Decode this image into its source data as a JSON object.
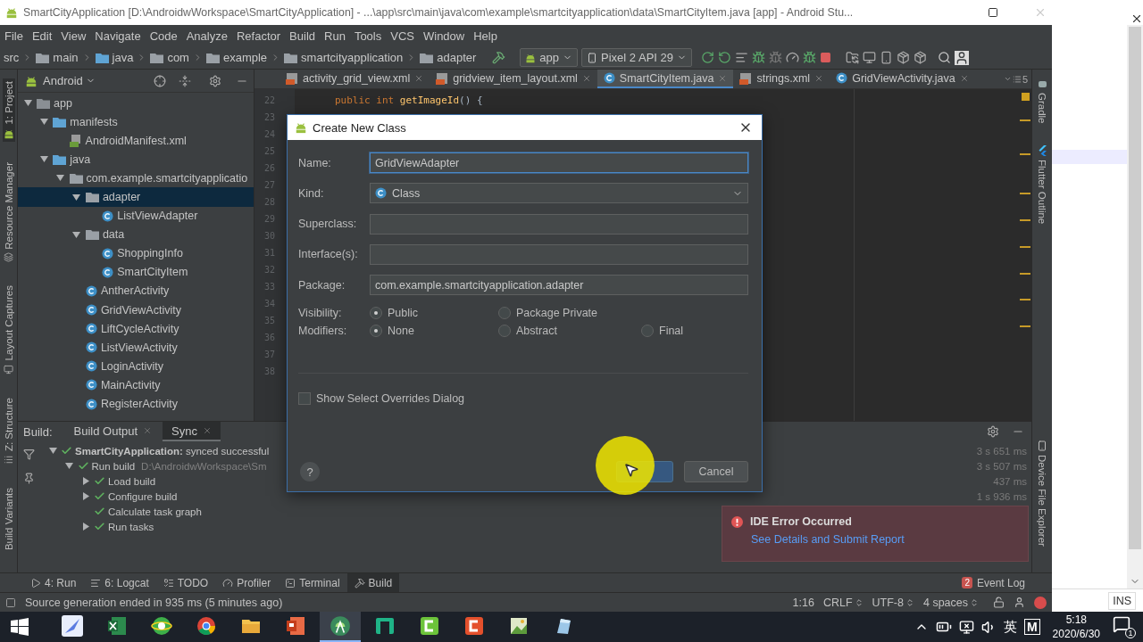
{
  "window": {
    "title": "SmartCityApplication [D:\\AndroidwWorkspace\\SmartCityApplication] - ...\\app\\src\\main\\java\\com\\example\\smartcityapplication\\data\\SmartCityItem.java [app] - Android Stu..."
  },
  "menu": [
    "File",
    "Edit",
    "View",
    "Navigate",
    "Code",
    "Analyze",
    "Refactor",
    "Build",
    "Run",
    "Tools",
    "VCS",
    "Window",
    "Help"
  ],
  "breadcrumbs": [
    "src",
    "main",
    "java",
    "com",
    "example",
    "smartcityapplication",
    "adapter"
  ],
  "run_config": "app",
  "device": "Pixel 2 API 29",
  "left_stripe": [
    {
      "label": "1: Project",
      "selected": true
    },
    {
      "label": "Resource Manager",
      "selected": false
    },
    {
      "label": "Layout Captures",
      "selected": false
    },
    {
      "label": "Z: Structure",
      "selected": false
    },
    {
      "label": "Build Variants",
      "selected": false
    }
  ],
  "project": {
    "view": "Android",
    "tree": [
      {
        "label": "app",
        "kind": "module",
        "expanded": true,
        "selected": false,
        "children": [
          {
            "label": "manifests",
            "kind": "folder",
            "expanded": true,
            "selected": false,
            "children": [
              {
                "label": "AndroidManifest.xml",
                "kind": "manifest",
                "selected": false
              }
            ]
          },
          {
            "label": "java",
            "kind": "folder",
            "expanded": true,
            "selected": false,
            "children": [
              {
                "label": "com.example.smartcityapplicatio",
                "kind": "package",
                "expanded": true,
                "selected": false,
                "children": [
                  {
                    "label": "adapter",
                    "kind": "package",
                    "expanded": true,
                    "selected": true,
                    "children": [
                      {
                        "label": "ListViewAdapter",
                        "kind": "class",
                        "selected": false
                      }
                    ]
                  },
                  {
                    "label": "data",
                    "kind": "package",
                    "expanded": true,
                    "selected": false,
                    "children": [
                      {
                        "label": "ShoppingInfo",
                        "kind": "class",
                        "selected": false
                      },
                      {
                        "label": "SmartCityItem",
                        "kind": "class",
                        "selected": false
                      }
                    ]
                  },
                  {
                    "label": "AntherActivity",
                    "kind": "class",
                    "selected": false
                  },
                  {
                    "label": "GridViewActivity",
                    "kind": "class",
                    "selected": false
                  },
                  {
                    "label": "LiftCycleActivity",
                    "kind": "class",
                    "selected": false
                  },
                  {
                    "label": "ListViewActivity",
                    "kind": "class",
                    "selected": false
                  },
                  {
                    "label": "LoginActivity",
                    "kind": "class",
                    "selected": false
                  },
                  {
                    "label": "MainActivity",
                    "kind": "class",
                    "selected": false
                  },
                  {
                    "label": "RegisterActivity",
                    "kind": "class",
                    "selected": false
                  }
                ]
              }
            ]
          }
        ]
      }
    ]
  },
  "editor": {
    "tabs": [
      {
        "label": "activity_grid_view.xml",
        "kind": "xml",
        "selected": false
      },
      {
        "label": "gridview_item_layout.xml",
        "kind": "xml",
        "selected": false
      },
      {
        "label": "SmartCityItem.java",
        "kind": "java",
        "selected": true
      },
      {
        "label": "strings.xml",
        "kind": "xml",
        "selected": false
      },
      {
        "label": "GridViewActivity.java",
        "kind": "java",
        "selected": false
      }
    ],
    "tab_overflow": "5",
    "line_numbers": [
      "22",
      "23",
      "24",
      "25",
      "26",
      "27",
      "28",
      "29",
      "30",
      "31",
      "32",
      "33",
      "34",
      "35",
      "36",
      "37",
      "38"
    ],
    "code": [
      {
        "kind": "keyword",
        "text": "public int "
      },
      {
        "kind": "method",
        "text": "getImageId"
      },
      {
        "kind": "plain",
        "text": "() {"
      }
    ]
  },
  "right_stripe": [
    "Gradle",
    "Flutter Outline",
    "Device File Explorer"
  ],
  "build": {
    "label": "Build:",
    "tabs": [
      {
        "label": "Build Output",
        "selected": false
      },
      {
        "label": "Sync",
        "selected": true
      }
    ],
    "tree": [
      {
        "text": "**SmartCityApplication:** synced successful",
        "time": "3 s 651 ms",
        "expanded": true,
        "children": [
          {
            "text": "Run build",
            "path": "D:\\AndroidwWorkspace\\Sm",
            "time": "3 s 507 ms",
            "expanded": true,
            "children": [
              {
                "text": "Load build",
                "time": "437 ms",
                "expanded": false
              },
              {
                "text": "Configure build",
                "time": "1 s 936 ms",
                "expanded": false
              },
              {
                "text": "Calculate task graph"
              },
              {
                "text": "Run tasks",
                "expanded": false
              }
            ]
          }
        ]
      }
    ]
  },
  "dialog": {
    "title": "Create New Class",
    "fields": [
      {
        "kind": "text",
        "label": "Name:",
        "value": "GridViewAdapter",
        "focused": true
      },
      {
        "kind": "select",
        "label": "Kind:",
        "value": "Class",
        "focused": false
      },
      {
        "kind": "text",
        "label": "Superclass:",
        "focused": false
      },
      {
        "kind": "text",
        "label": "Interface(s):",
        "focused": false
      },
      {
        "kind": "text",
        "label": "Package:",
        "value": "com.example.smartcityapplication.adapter",
        "focused": false
      }
    ],
    "visibility": {
      "label": "Visibility:",
      "options": [
        {
          "label": "Public",
          "selected": true
        },
        {
          "label": "Package Private",
          "selected": false
        }
      ]
    },
    "modifiers": {
      "label": "Modifiers:",
      "options": [
        {
          "label": "None",
          "selected": true
        },
        {
          "label": "Abstract",
          "selected": false
        },
        {
          "label": "Final",
          "selected": false
        }
      ]
    },
    "show_overrides": {
      "label": "Show Select Overrides Dialog",
      "checked": false
    },
    "help": "?",
    "cancel": "Cancel"
  },
  "notification": {
    "title": "IDE Error Occurred",
    "link": "See Details and Submit Report"
  },
  "tool_windows": [
    {
      "kind": "run",
      "label": "4: Run",
      "selected": false
    },
    {
      "kind": "logcat",
      "label": "6: Logcat",
      "selected": false
    },
    {
      "kind": "todo",
      "label": "TODO",
      "selected": false
    },
    {
      "kind": "profiler",
      "label": "Profiler",
      "selected": false
    },
    {
      "kind": "terminal",
      "label": "Terminal",
      "selected": false
    },
    {
      "kind": "build",
      "label": "Build",
      "selected": true
    }
  ],
  "event_log": {
    "count": "2",
    "label": "Event Log"
  },
  "status": {
    "message": "Source generation ended in 935 ms (5 minutes ago)",
    "position": "1:16",
    "line_separator": "CRLF",
    "encoding": "UTF-8",
    "indent": "4 spaces"
  },
  "side_window": {
    "mode": "INS"
  },
  "taskbar": {
    "apps": [
      {
        "kind": "feather",
        "selected": false
      },
      {
        "kind": "sheet",
        "selected": false
      },
      {
        "kind": "browser",
        "selected": false
      },
      {
        "kind": "chrome",
        "selected": false
      },
      {
        "kind": "folder",
        "selected": false
      },
      {
        "kind": "slides",
        "selected": false
      },
      {
        "kind": "android",
        "selected": true
      },
      {
        "kind": "notes",
        "selected": false
      },
      {
        "kind": "green-c",
        "selected": false
      },
      {
        "kind": "red-c",
        "selected": false
      },
      {
        "kind": "image",
        "selected": false
      },
      {
        "kind": "glass",
        "selected": false
      }
    ],
    "tray": {
      "ime": "英",
      "ime_mode": "M",
      "time": "5:18",
      "date": "2020/6/30",
      "notifications": "1"
    }
  }
}
